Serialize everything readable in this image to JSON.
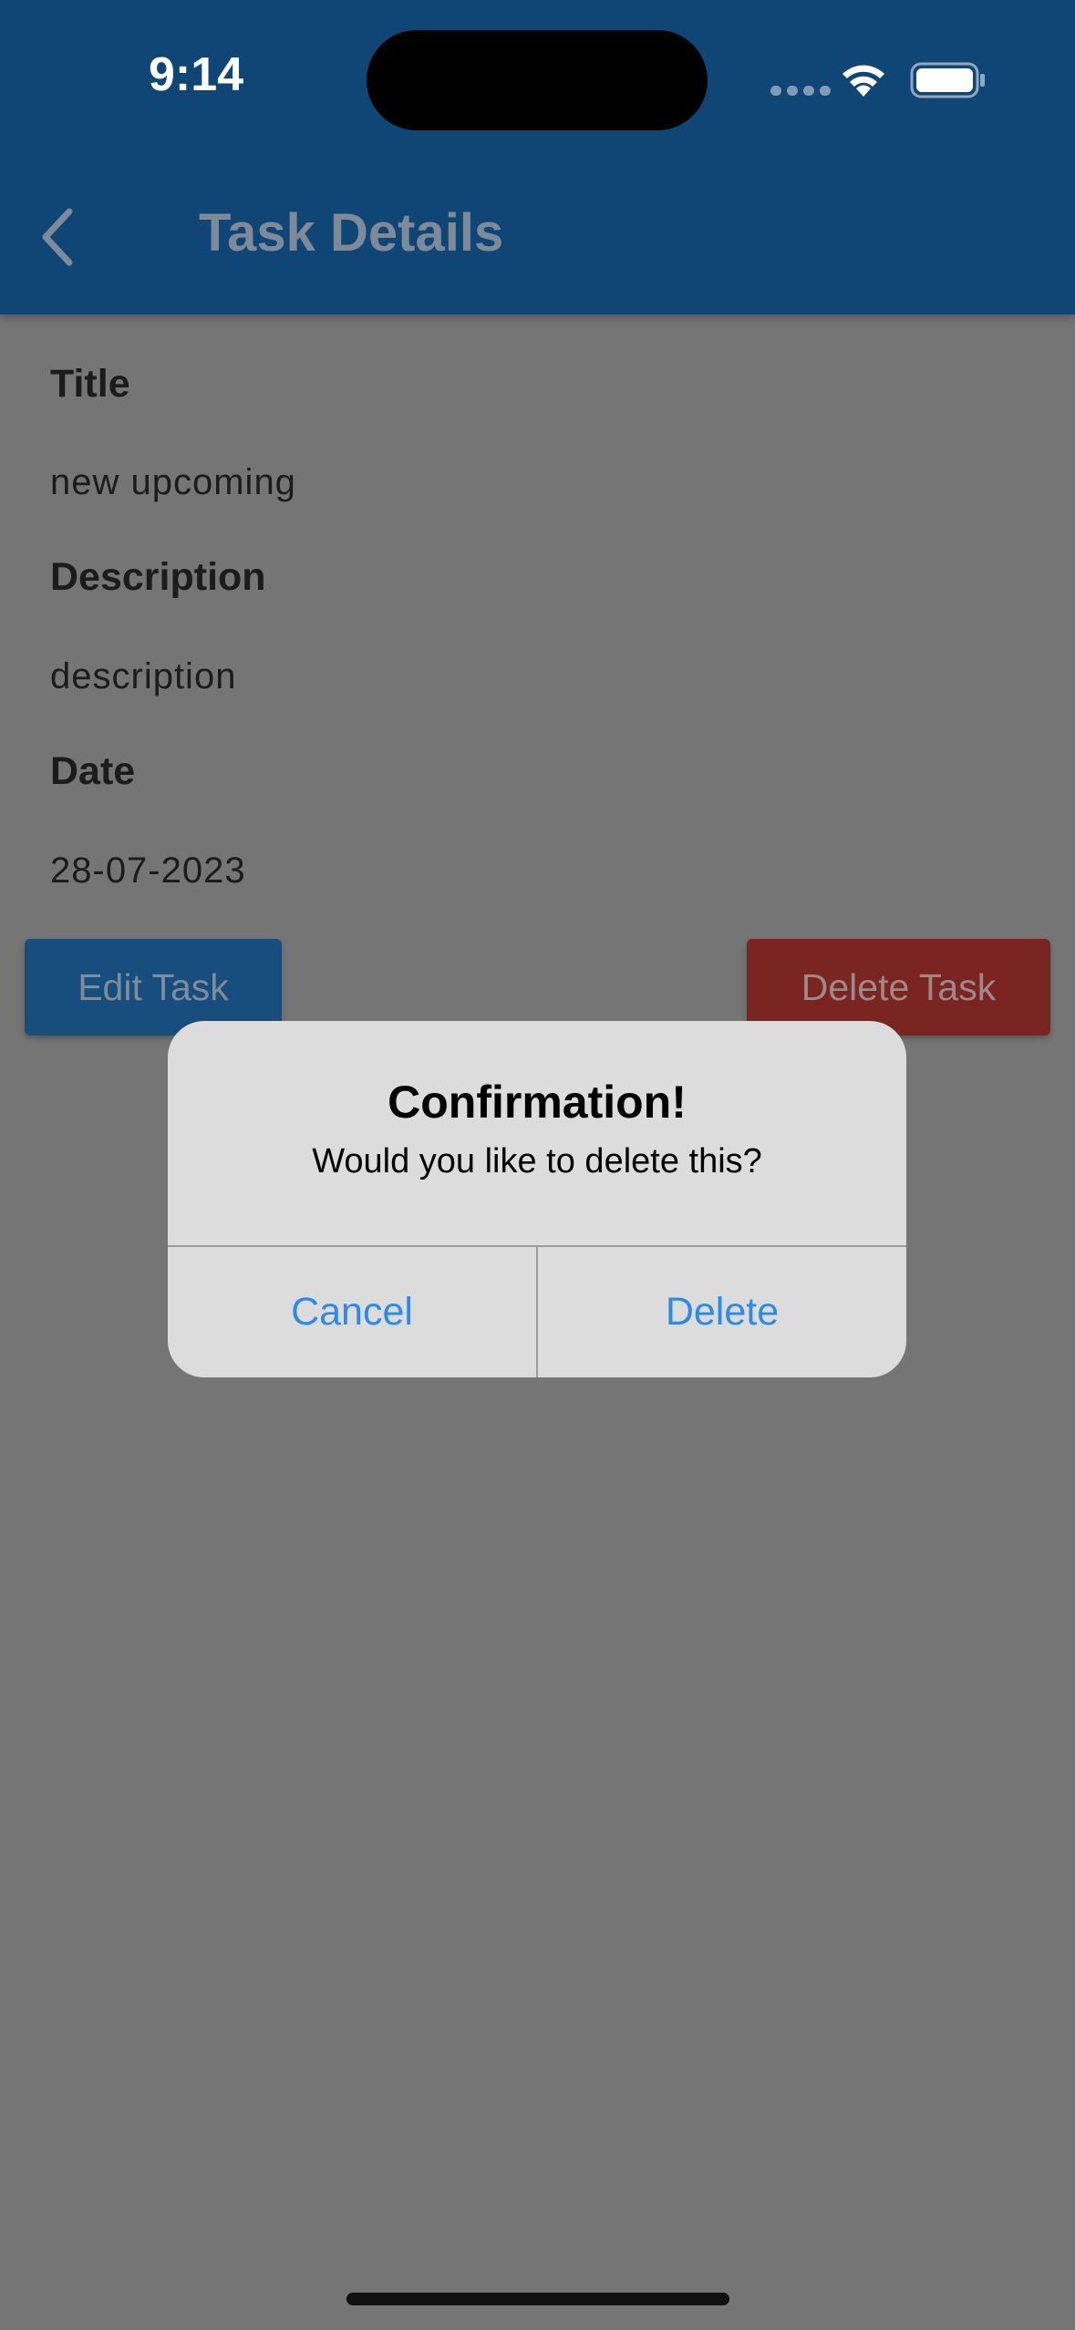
{
  "status_bar": {
    "time": "9:14",
    "icons": [
      "signal-dots-icon",
      "wifi-icon",
      "battery-icon"
    ]
  },
  "app_bar": {
    "title": "Task Details",
    "back_icon": "chevron-left-icon"
  },
  "task": {
    "title_label": "Title",
    "title_value": "new upcoming",
    "description_label": "Description",
    "description_value": "description",
    "date_label": "Date",
    "date_value": "28-07-2023"
  },
  "actions": {
    "edit_label": "Edit Task",
    "delete_label": "Delete Task"
  },
  "dialog": {
    "title": "Confirmation!",
    "message": "Would you like to delete this?",
    "cancel_label": "Cancel",
    "delete_label": "Delete"
  },
  "colors": {
    "app_bar": "#0f4675",
    "scrim_background": "#757575",
    "edit_button": "#174e7d",
    "delete_button": "#7b2523",
    "dialog_background": "#dcdcdc",
    "dialog_action": "#2e8ae6"
  }
}
